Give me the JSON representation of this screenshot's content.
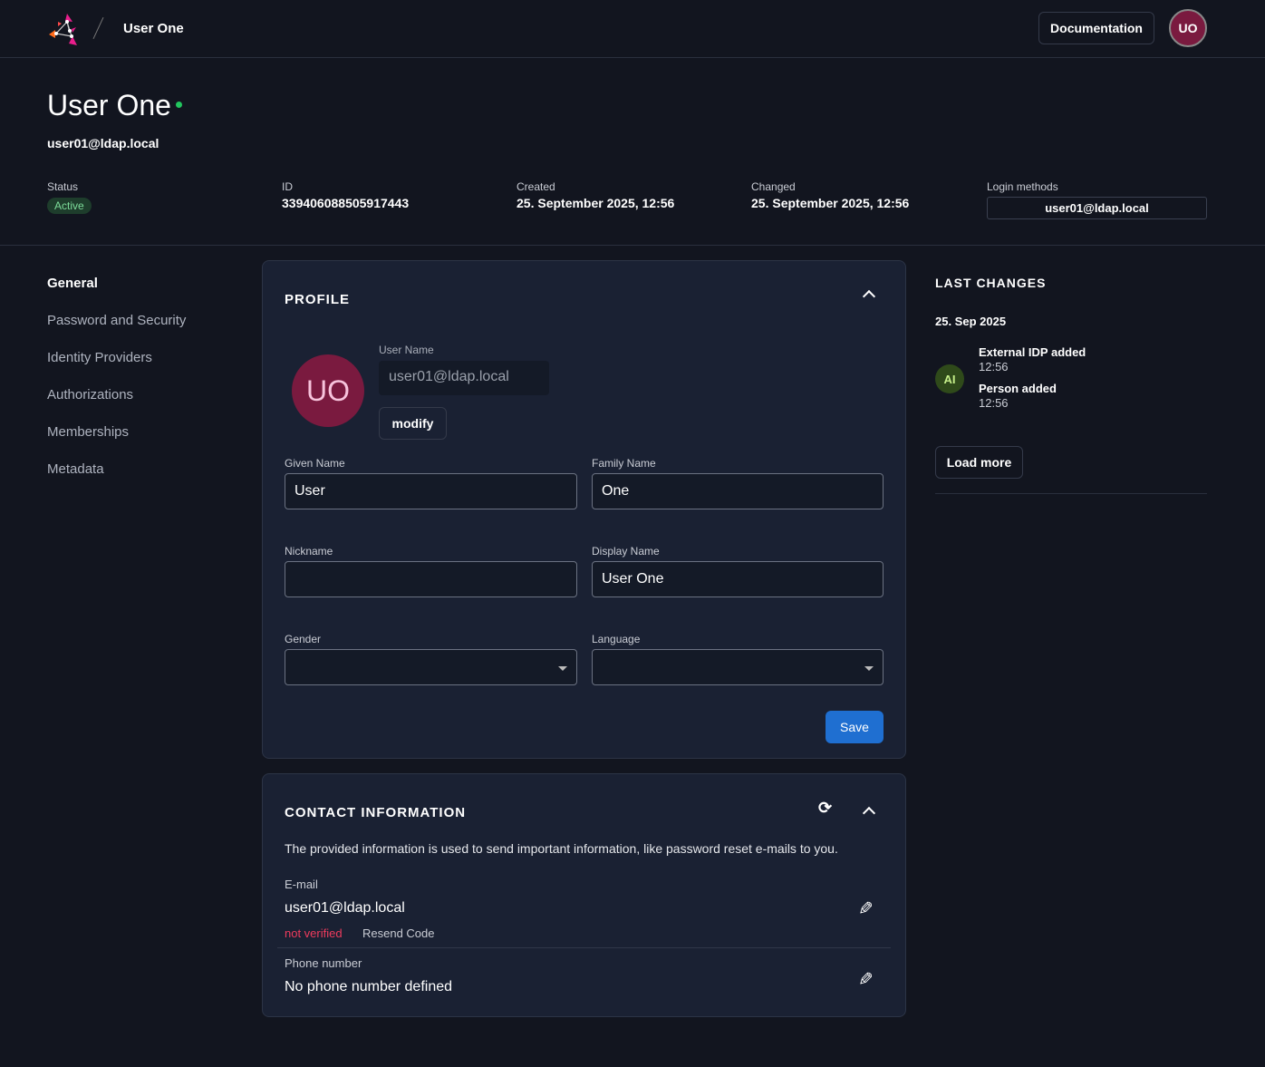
{
  "header": {
    "breadcrumb": "User One",
    "documentation": "Documentation",
    "avatar": "UO"
  },
  "user": {
    "name": "User One",
    "email": "user01@ldap.local"
  },
  "meta": {
    "status_label": "Status",
    "status": "Active",
    "id_label": "ID",
    "id": "339406088505917443",
    "created_label": "Created",
    "created": "25. September 2025, 12:56",
    "changed_label": "Changed",
    "changed": "25. September 2025, 12:56",
    "login_label": "Login methods",
    "login": "user01@ldap.local"
  },
  "nav": [
    "General",
    "Password and Security",
    "Identity Providers",
    "Authorizations",
    "Memberships",
    "Metadata"
  ],
  "profile": {
    "title": "PROFILE",
    "avatar": "UO",
    "username_label": "User Name",
    "username": "user01@ldap.local",
    "modify": "modify",
    "given_label": "Given Name",
    "given": "User",
    "family_label": "Family Name",
    "family": "One",
    "nickname_label": "Nickname",
    "nickname": "",
    "display_label": "Display Name",
    "display": "User One",
    "gender_label": "Gender",
    "language_label": "Language",
    "save": "Save"
  },
  "contact": {
    "title": "CONTACT INFORMATION",
    "desc": "The provided information is used to send important information, like password reset e-mails to you.",
    "email_label": "E-mail",
    "email": "user01@ldap.local",
    "not_verified": "not verified",
    "resend": "Resend Code",
    "phone_label": "Phone number",
    "phone": "No phone number defined"
  },
  "changes": {
    "title": "LAST CHANGES",
    "date": "25. Sep 2025",
    "avatar": "AI",
    "items": [
      {
        "label": "External IDP added",
        "time": "12:56"
      },
      {
        "label": "Person added",
        "time": "12:56"
      }
    ],
    "load_more": "Load more"
  }
}
